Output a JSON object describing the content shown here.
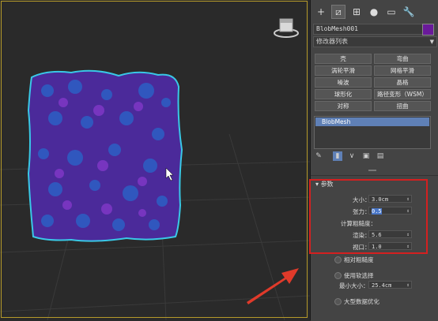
{
  "panel": {
    "tabs": [
      {
        "icon": "plus-icon",
        "glyph": "+"
      },
      {
        "icon": "modify-icon",
        "glyph": "⧄"
      },
      {
        "icon": "hierarchy-icon",
        "glyph": "⊞"
      },
      {
        "icon": "motion-icon",
        "glyph": "●"
      },
      {
        "icon": "display-icon",
        "glyph": "▭"
      },
      {
        "icon": "utilities-icon",
        "glyph": "🔧"
      }
    ],
    "object_name": "BlobMesh001",
    "object_color": "#6a1a9a",
    "modifier_list": "修改器列表",
    "buttons": [
      [
        "壳",
        "弯曲"
      ],
      [
        "涡轮平滑",
        "网格平滑"
      ],
      [
        "噪波",
        "晶格"
      ],
      [
        "球形化",
        "路径变形（WSM）"
      ],
      [
        "对称",
        "扭曲"
      ]
    ],
    "stack_item": "BlobMesh",
    "rollout_title": "参数",
    "size_label": "大小：",
    "size_value": "3.0cm",
    "tension_label": "张力：",
    "tension_value": "0.5",
    "eval_label": "计算粗糙度：",
    "render_label": "渲染：",
    "render_value": "5.6",
    "viewport_label": "视口：",
    "viewport_value": "1.0",
    "relative_label": "相对粗糙度",
    "use_soft_label": "使用软选择",
    "min_size_label": "最小大小：",
    "min_size_value": "25.4cm",
    "large_data_label": "大型数据优化"
  },
  "colors": {
    "accent": "#5f80b6",
    "highlight_box": "#d42020",
    "arrow": "#e03a2a",
    "blob_fill": "#4b2a9a",
    "blob_outline": "#39c8e6"
  }
}
